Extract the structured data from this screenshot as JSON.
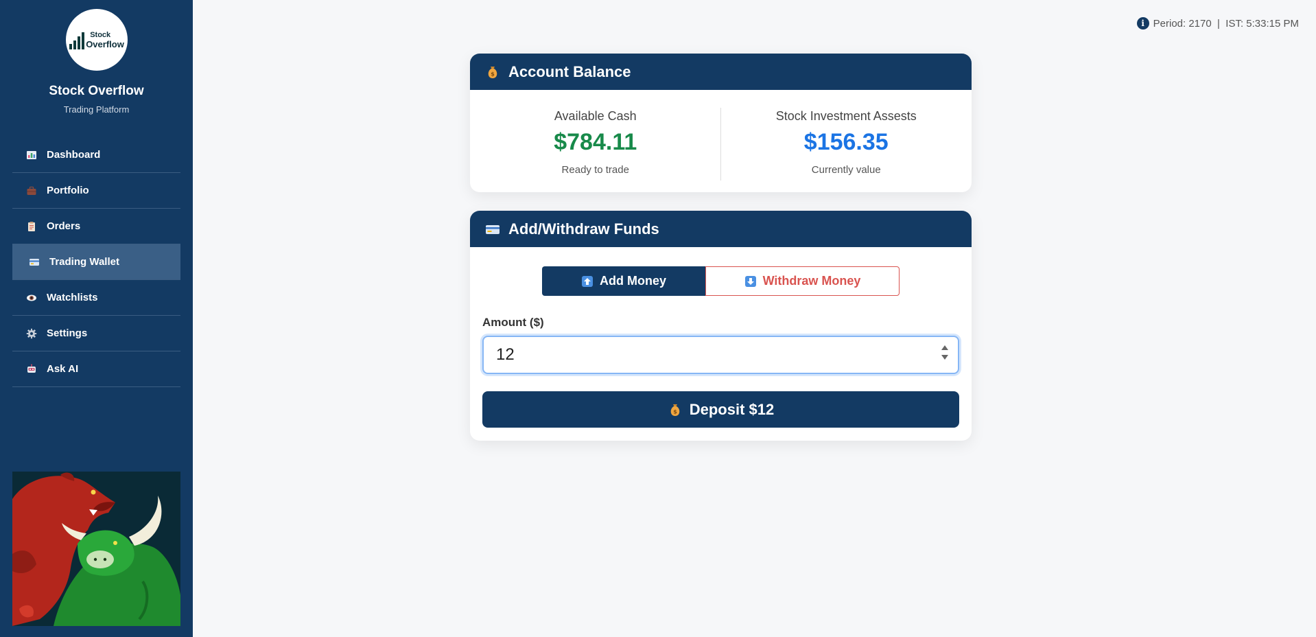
{
  "brand": {
    "logo_line1": "Stock",
    "logo_line2": "Overflow",
    "name": "Stock Overflow",
    "subtitle": "Trading Platform"
  },
  "sidebar": {
    "items": [
      {
        "label": "Dashboard",
        "icon": "bar-chart-icon",
        "active": false
      },
      {
        "label": "Portfolio",
        "icon": "briefcase-icon",
        "active": false
      },
      {
        "label": "Orders",
        "icon": "clipboard-icon",
        "active": false
      },
      {
        "label": "Trading Wallet",
        "icon": "credit-card-icon",
        "active": true
      },
      {
        "label": "Watchlists",
        "icon": "eye-icon",
        "active": false
      },
      {
        "label": "Settings",
        "icon": "gear-icon",
        "active": false
      },
      {
        "label": "Ask AI",
        "icon": "robot-icon",
        "active": false
      }
    ]
  },
  "topbar": {
    "info_icon_text": "i",
    "status": "Period: 2170  |  IST: 5:33:15 PM"
  },
  "balance": {
    "title": "Account Balance",
    "cash_label": "Available Cash",
    "cash_value": "$784.11",
    "cash_note": "Ready to trade",
    "assets_label": "Stock Investment Assests",
    "assets_value": "$156.35",
    "assets_note": "Currently value"
  },
  "funds": {
    "title": "Add/Withdraw Funds",
    "add_label": "Add Money",
    "withdraw_label": "Withdraw Money",
    "amount_label": "Amount ($)",
    "amount_value": "12",
    "deposit_label": "Deposit $12"
  },
  "colors": {
    "primary": "#133a63",
    "cash_green": "#188a4a",
    "assets_blue": "#1b74e4",
    "withdraw_red": "#d9534f"
  }
}
